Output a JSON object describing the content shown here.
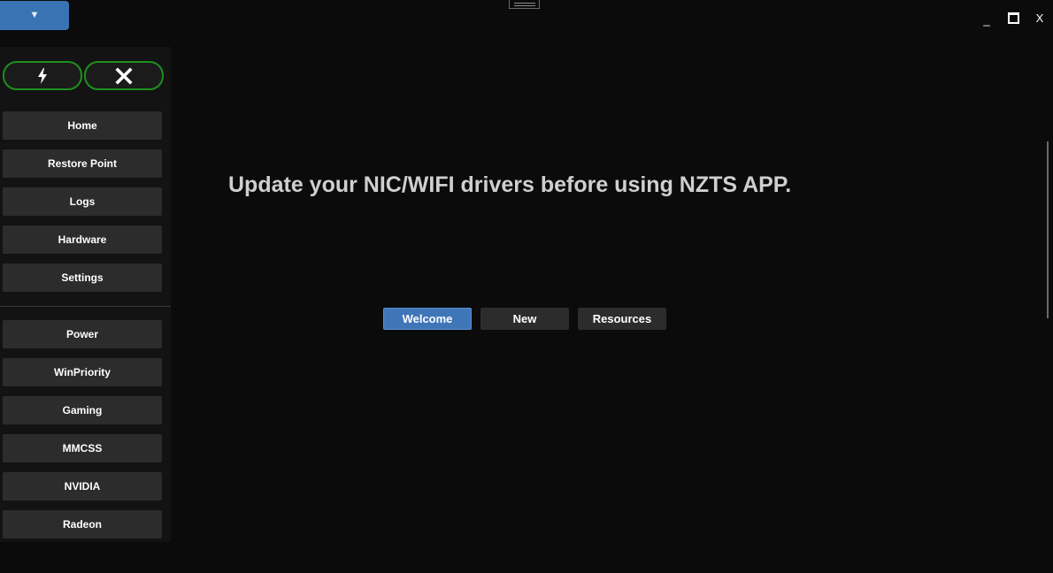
{
  "window": {
    "menu_toggle_icon": "chevron-down-icon",
    "menu_toggle_glyph": "▼",
    "drag_handle_icon": "drag-handle-icon",
    "minimize_label": "_",
    "maximize_icon": "maximize-icon",
    "close_label": "X"
  },
  "sidebar": {
    "quick_actions": [
      {
        "name": "lightning-icon",
        "color": "#ffffff"
      },
      {
        "name": "close-icon",
        "color": "#ffffff"
      }
    ],
    "accent_color": "#1e8f1e",
    "primary_items": [
      {
        "label": "Home"
      },
      {
        "label": "Restore Point"
      },
      {
        "label": "Logs"
      },
      {
        "label": "Hardware"
      },
      {
        "label": "Settings"
      }
    ],
    "secondary_items": [
      {
        "label": "Power"
      },
      {
        "label": "WinPriority"
      },
      {
        "label": "Gaming"
      },
      {
        "label": "MMCSS"
      },
      {
        "label": "NVIDIA"
      },
      {
        "label": "Radeon"
      }
    ]
  },
  "main": {
    "headline": "Update your NIC/WIFI drivers before using NZTS APP.",
    "tabs": [
      {
        "label": "Welcome",
        "active": true
      },
      {
        "label": "New",
        "active": false
      },
      {
        "label": "Resources",
        "active": false
      }
    ],
    "active_tab_color": "#3f76b8"
  }
}
